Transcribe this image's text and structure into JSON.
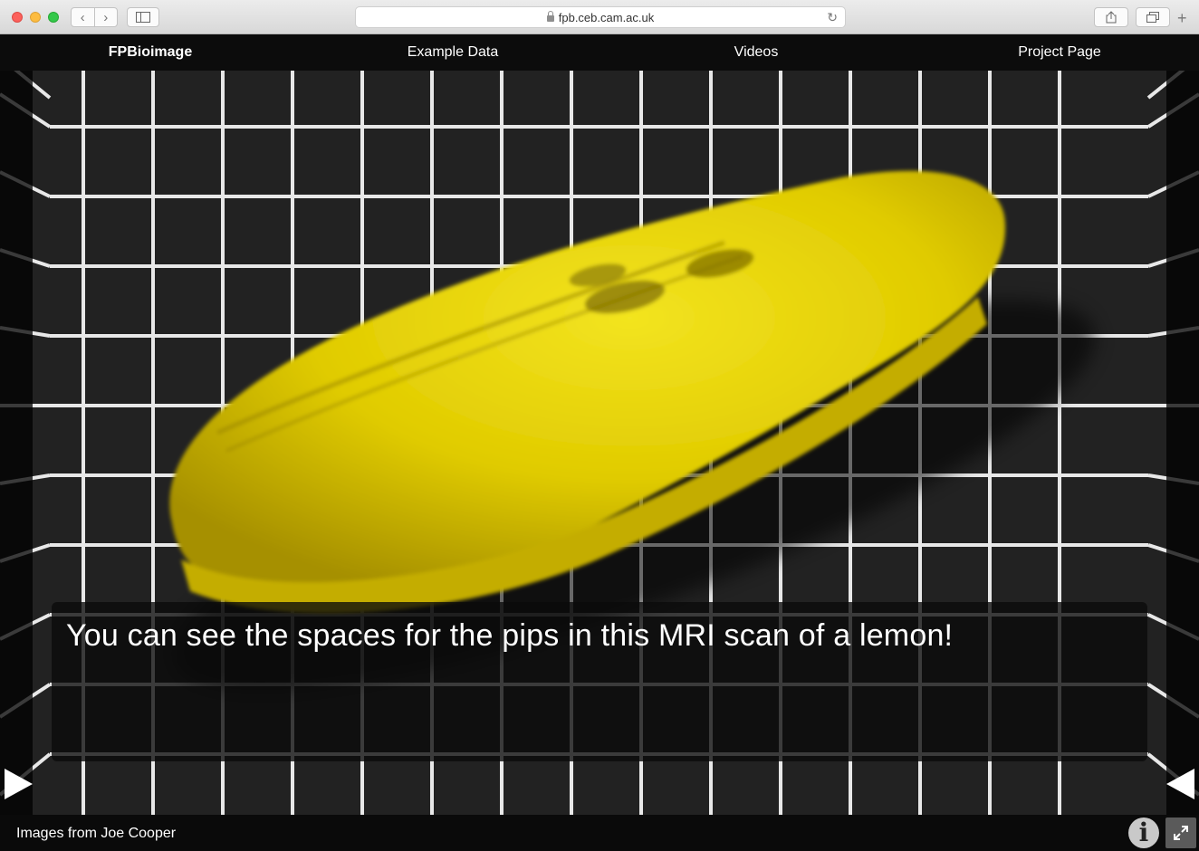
{
  "browser": {
    "url": "fpb.ceb.cam.ac.uk",
    "back_icon": "‹",
    "forward_icon": "›",
    "reload_icon": "↻",
    "new_tab_icon": "+"
  },
  "nav": {
    "brand": "FPBioimage",
    "items": [
      "Example Data",
      "Videos",
      "Project Page"
    ]
  },
  "viewer": {
    "caption": "You can see the spaces for the pips in this MRI scan of a lemon!",
    "object_color": "#e6d400",
    "grid_color": "#e8e8e8"
  },
  "footer": {
    "credit": "Images from Joe Cooper",
    "info_icon": "i"
  }
}
